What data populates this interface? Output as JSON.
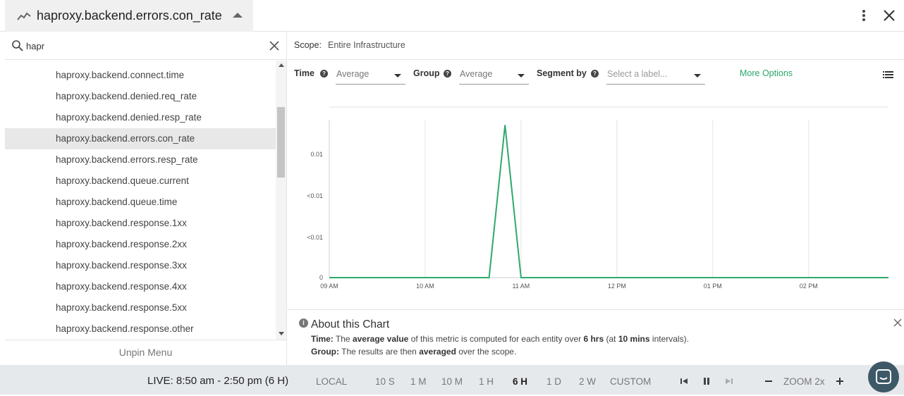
{
  "header": {
    "title": "haproxy.backend.errors.con_rate",
    "icon": "line-chart-icon"
  },
  "sidebar": {
    "search": {
      "value": "hapr",
      "placeholder": ""
    },
    "items": [
      {
        "label": "haproxy.backend.connect.time"
      },
      {
        "label": "haproxy.backend.denied.req_rate"
      },
      {
        "label": "haproxy.backend.denied.resp_rate"
      },
      {
        "label": "haproxy.backend.errors.con_rate",
        "selected": true
      },
      {
        "label": "haproxy.backend.errors.resp_rate"
      },
      {
        "label": "haproxy.backend.queue.current"
      },
      {
        "label": "haproxy.backend.queue.time"
      },
      {
        "label": "haproxy.backend.response.1xx"
      },
      {
        "label": "haproxy.backend.response.2xx"
      },
      {
        "label": "haproxy.backend.response.3xx"
      },
      {
        "label": "haproxy.backend.response.4xx"
      },
      {
        "label": "haproxy.backend.response.5xx"
      },
      {
        "label": "haproxy.backend.response.other"
      }
    ],
    "unpin_label": "Unpin Menu"
  },
  "scope": {
    "label": "Scope:",
    "value": "Entire Infrastructure"
  },
  "controls": {
    "time_label": "Time",
    "time_value": "Average",
    "group_label": "Group",
    "group_value": "Average",
    "segment_label": "Segment by",
    "segment_placeholder": "Select a label...",
    "more_options": "More Options"
  },
  "chart_data": {
    "type": "line",
    "title": "",
    "xlabel": "",
    "ylabel": "",
    "x_ticks": [
      "09 AM",
      "10 AM",
      "11 AM",
      "12 PM",
      "01 PM",
      "02 PM"
    ],
    "y_ticks": [
      "0",
      "<0.01",
      "<0.01",
      "0.01"
    ],
    "ylim": [
      0,
      0.0119
    ],
    "grid": true,
    "series": [
      {
        "color": "#2eaa6b",
        "x": [
          "09:00",
          "10:20",
          "10:40",
          "10:50",
          "11:00",
          "12:00",
          "13:00",
          "14:00",
          "14:50"
        ],
        "y": [
          0,
          0,
          0,
          0.0115,
          0,
          0,
          0,
          0,
          0
        ]
      }
    ]
  },
  "about": {
    "title": "About this Chart",
    "time_label": "Time:",
    "time_pre": "The",
    "time_bold1": "average value",
    "time_mid": "of this metric is computed for each entity over",
    "time_bold2": "6 hrs",
    "time_mid2": "(at",
    "time_bold3": "10 mins",
    "time_post": "intervals).",
    "group_label": "Group:",
    "group_pre": "The results are then",
    "group_bold": "averaged",
    "group_post": "over the scope."
  },
  "footer": {
    "live": "LIVE: 8:50 am - 2:50 pm (6 H)",
    "local": "LOCAL",
    "ranges": [
      "10 S",
      "1 M",
      "10 M",
      "1 H",
      "6 H",
      "1 D",
      "2 W",
      "CUSTOM"
    ],
    "active_range": "6 H",
    "zoom": "ZOOM 2x"
  }
}
